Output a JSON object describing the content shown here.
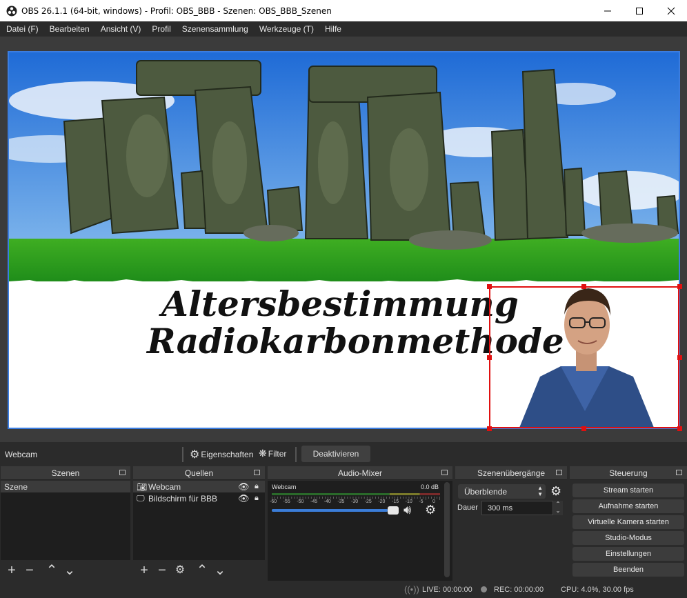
{
  "window": {
    "title": "OBS 26.1.1 (64-bit, windows) - Profil: OBS_BBB - Szenen: OBS_BBB_Szenen",
    "minimize_icon": "minimize-icon",
    "maximize_icon": "maximize-icon",
    "close_icon": "close-icon"
  },
  "menu": [
    "Datei (F)",
    "Bearbeiten",
    "Ansicht (V)",
    "Profil",
    "Szenensammlung",
    "Werkzeuge (T)",
    "Hilfe"
  ],
  "preview": {
    "title_line1": "Altersbestimmung",
    "title_line2": "Radiokarbonmethode"
  },
  "source_toolbar": {
    "selected_source": "Webcam",
    "properties_label": "Eigenschaften",
    "filter_label": "Filter",
    "deactivate_label": "Deaktivieren"
  },
  "scenes": {
    "header": "Szenen",
    "items": [
      "Szene"
    ]
  },
  "sources": {
    "header": "Quellen",
    "items": [
      {
        "label": "Webcam",
        "icon": "camera-icon"
      },
      {
        "label": "Bildschirm für BBB",
        "icon": "monitor-icon"
      }
    ]
  },
  "mixer": {
    "header": "Audio-Mixer",
    "channel": "Webcam",
    "level": "0.0 dB",
    "ticks": [
      "-60",
      "-55",
      "-50",
      "-45",
      "-40",
      "-35",
      "-30",
      "-25",
      "-20",
      "-15",
      "-10",
      "-5",
      "0"
    ],
    "volume_fraction": 1.0
  },
  "transitions": {
    "header": "Szenenübergänge",
    "selected": "Überblende",
    "duration_label": "Dauer",
    "duration_value": "300 ms"
  },
  "controls": {
    "header": "Steuerung",
    "buttons": [
      "Stream starten",
      "Aufnahme starten",
      "Virtuelle Kamera starten",
      "Studio-Modus",
      "Einstellungen",
      "Beenden"
    ]
  },
  "status": {
    "live": "LIVE: 00:00:00",
    "rec": "REC: 00:00:00",
    "cpu": "CPU: 4.0%, 30.00 fps"
  }
}
